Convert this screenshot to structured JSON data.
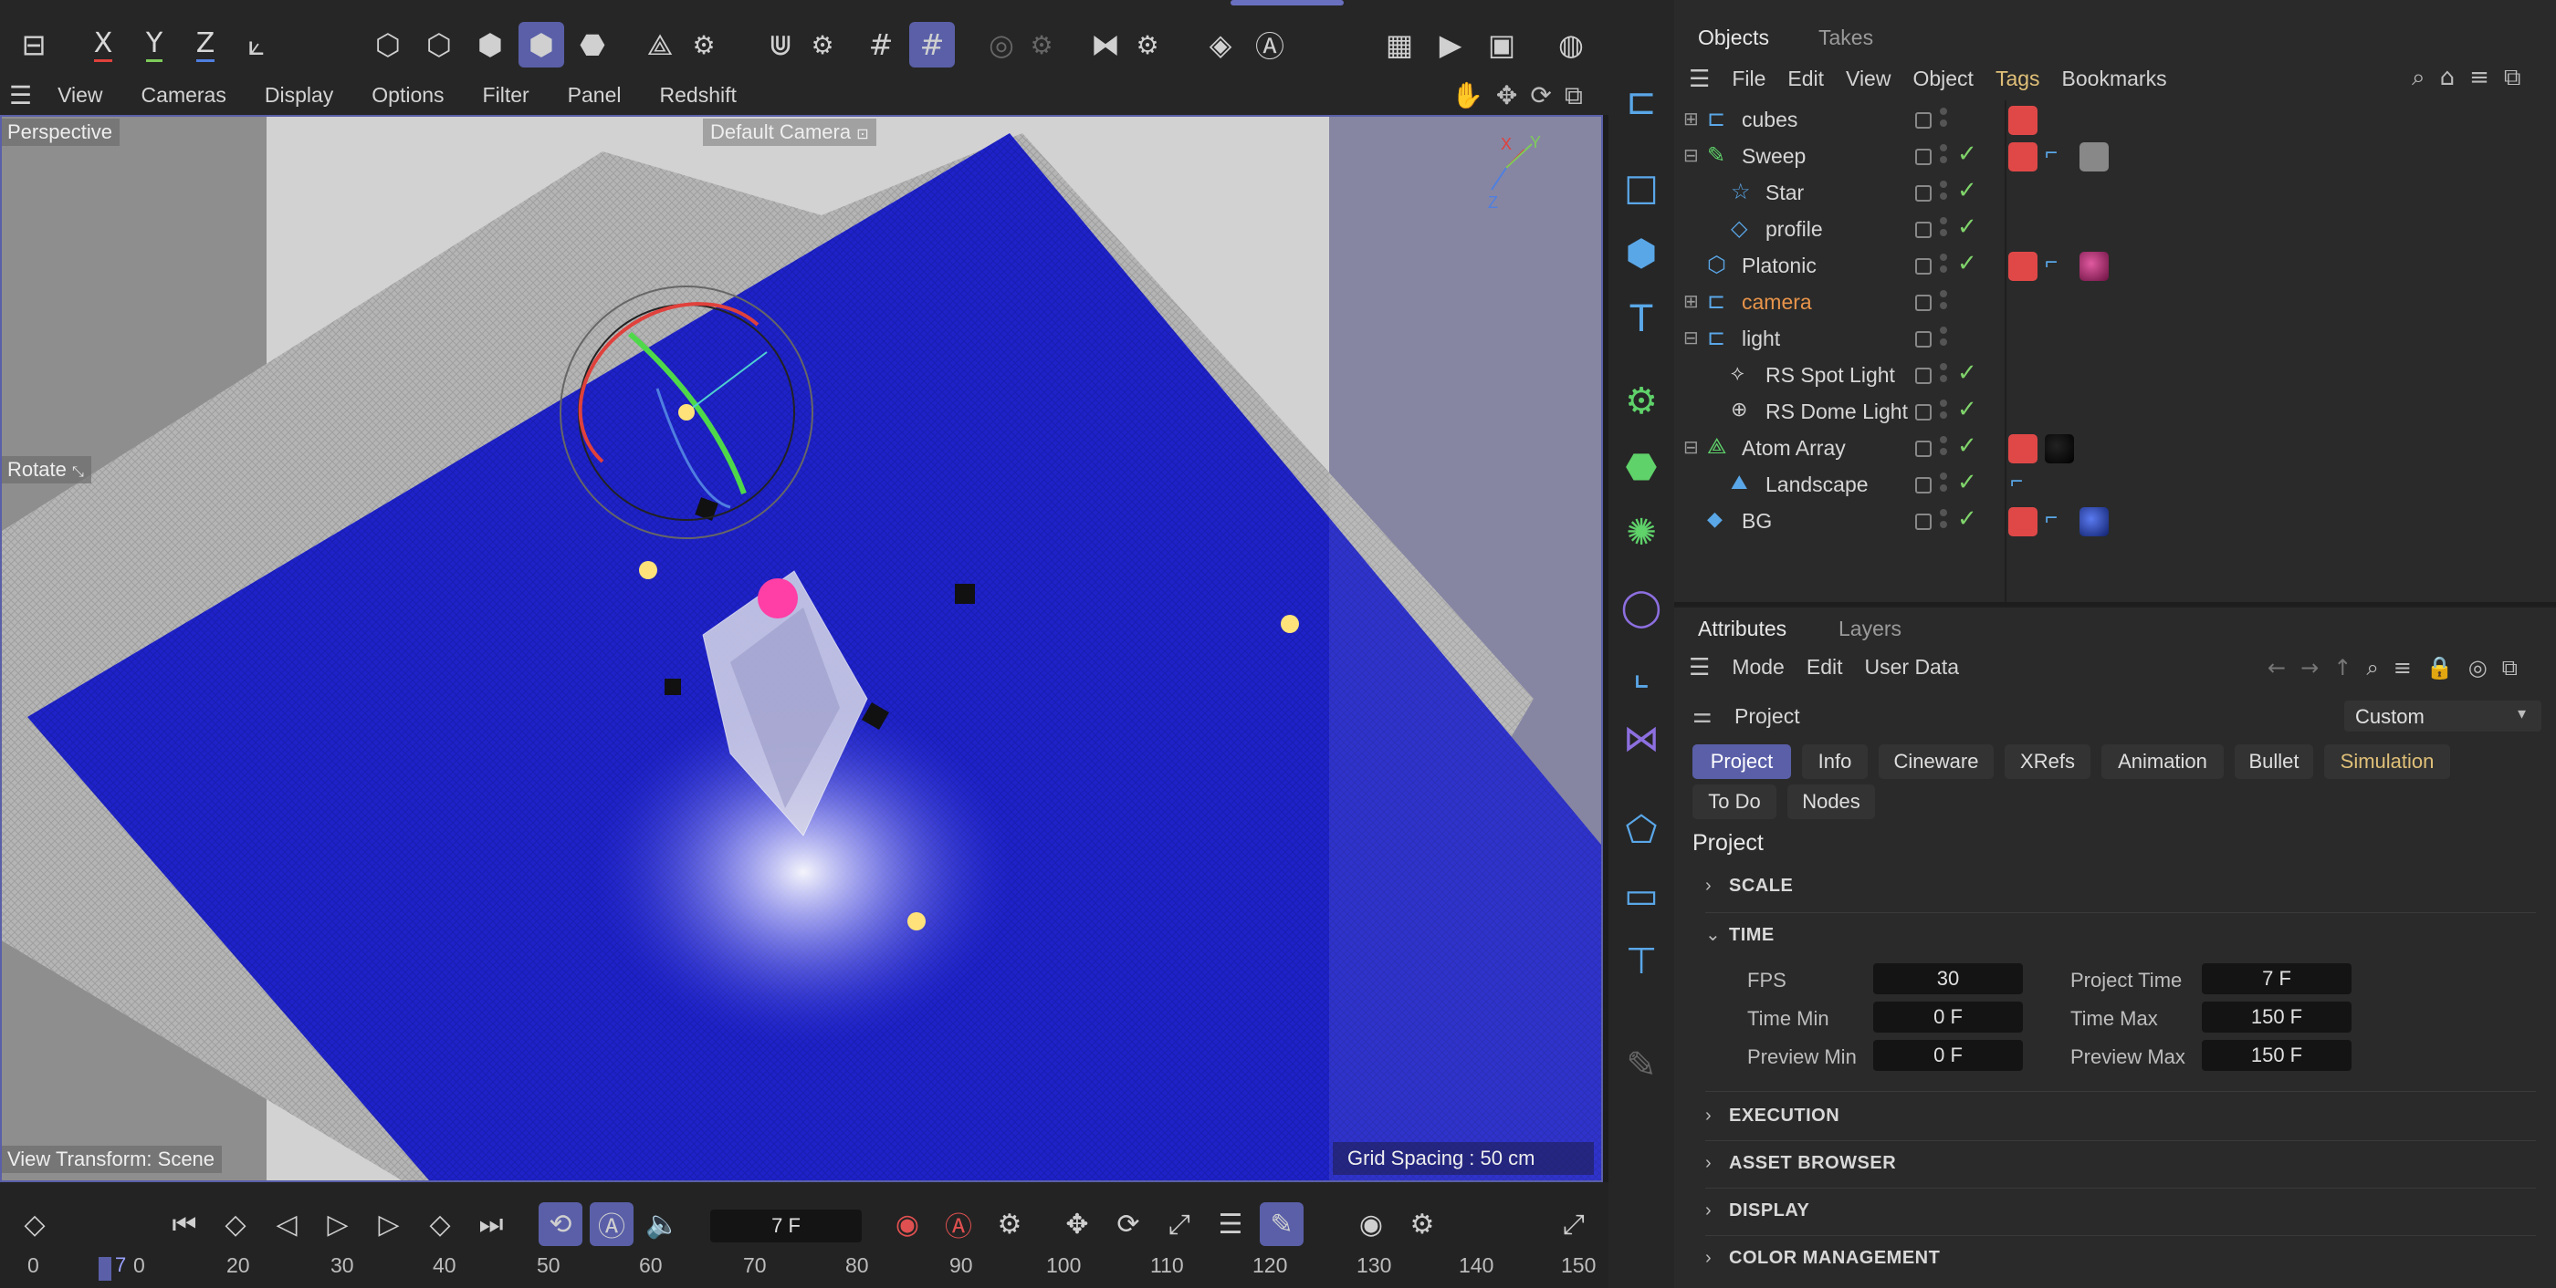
{
  "toolbar": {
    "axis_x": "X",
    "axis_y": "Y",
    "axis_z": "Z",
    "colors": {
      "x": "#e0413c",
      "y": "#7ecb5a",
      "z": "#4f7fe0",
      "accent": "#5a5fa8"
    }
  },
  "viewport_menu": {
    "items": [
      "View",
      "Cameras",
      "Display",
      "Options",
      "Filter",
      "Panel",
      "Redshift"
    ]
  },
  "viewport": {
    "perspective_label": "Perspective",
    "camera_label": "Default Camera",
    "rotate_label": "Rotate",
    "view_transform": "View Transform: Scene",
    "grid_spacing": "Grid Spacing : 50 cm",
    "axis_x": "X",
    "axis_y": "Y",
    "axis_z": "Z",
    "plane_color": "#1e22c8"
  },
  "objects_panel": {
    "tabs": [
      "Objects",
      "Takes"
    ],
    "menu": [
      "File",
      "Edit",
      "View",
      "Object",
      "Tags",
      "Bookmarks"
    ],
    "active_menu": "Tags",
    "rows": [
      {
        "name": "cubes",
        "expander": "+",
        "tags": [
          "red-cube"
        ]
      },
      {
        "name": "Sweep",
        "expander": "−",
        "check": "✓",
        "tags": [
          "red-cube",
          "flag",
          "texture"
        ]
      },
      {
        "name": "Star",
        "check": "✓",
        "tags": []
      },
      {
        "name": "profile",
        "check": "✓",
        "tags": []
      },
      {
        "name": "Platonic",
        "check": "✓",
        "tags": [
          "red-cube",
          "flag",
          "magenta-sphere"
        ]
      },
      {
        "name": "camera",
        "expander": "+",
        "tags": []
      },
      {
        "name": "light",
        "expander": "−",
        "tags": []
      },
      {
        "name": "RS Spot Light",
        "check": "✓",
        "tags": []
      },
      {
        "name": "RS Dome Light",
        "check": "✓",
        "tags": []
      },
      {
        "name": "Atom Array",
        "expander": "−",
        "check": "✓",
        "tags": [
          "red-cube",
          "black-sphere"
        ]
      },
      {
        "name": "Landscape",
        "check": "✓",
        "tags": [
          "flag"
        ]
      },
      {
        "name": "BG",
        "check": "✓",
        "tags": [
          "red-cube",
          "flag",
          "blue-sphere"
        ]
      }
    ]
  },
  "attributes_panel": {
    "tabs": [
      "Attributes",
      "Layers"
    ],
    "menu": [
      "Mode",
      "Edit",
      "User Data"
    ],
    "header_label": "Project",
    "preset": "Custom",
    "pills": [
      "Project",
      "Info",
      "Cineware",
      "XRefs",
      "Animation",
      "Bullet",
      "Simulation",
      "To Do",
      "Nodes"
    ],
    "section_title": "Project",
    "sections": {
      "scale": "SCALE",
      "time": "TIME",
      "execution": "EXECUTION",
      "asset_browser": "ASSET BROWSER",
      "display": "DISPLAY",
      "color_management": "COLOR MANAGEMENT"
    },
    "time_fields": {
      "fps_label": "FPS",
      "fps": "30",
      "project_time_label": "Project Time",
      "project_time": "7 F",
      "time_min_label": "Time Min",
      "time_min": "0 F",
      "time_max_label": "Time Max",
      "time_max": "150 F",
      "preview_min_label": "Preview Min",
      "preview_min": "0 F",
      "preview_max_label": "Preview Max",
      "preview_max": "150 F"
    }
  },
  "timeline": {
    "current_frame": "7 F",
    "playhead_frame": "7",
    "ticks": [
      "0",
      "20",
      "30",
      "40",
      "50",
      "60",
      "70",
      "80",
      "90",
      "100",
      "110",
      "120",
      "130",
      "140",
      "150"
    ],
    "tick_zero_small": "0"
  }
}
